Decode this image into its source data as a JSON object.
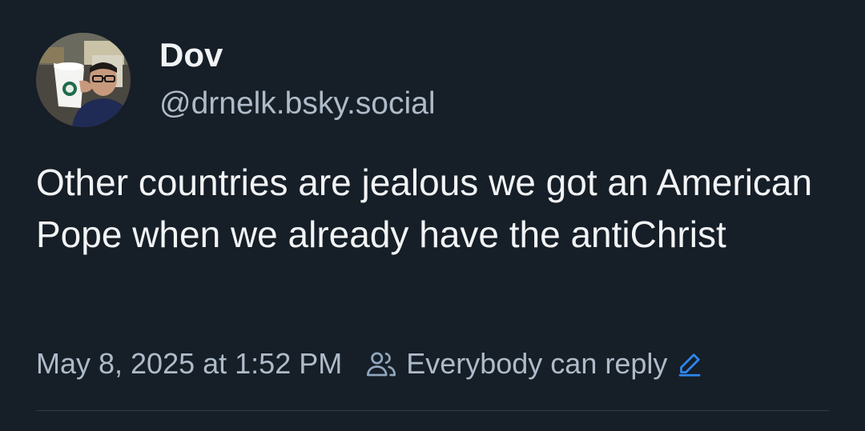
{
  "author": {
    "display_name": "Dov",
    "handle": "@drnelk.bsky.social",
    "avatar_icon": "avatar"
  },
  "post": {
    "text": "Other countries are jealous we got an American Pope when we already have the antiChrist",
    "timestamp": "May 8, 2025 at 1:52 PM"
  },
  "reply_settings": {
    "label": "Everybody can reply",
    "icon": "people-icon",
    "edit_icon": "pencil-icon"
  },
  "colors": {
    "background": "#161e27",
    "text_primary": "#f1f3f5",
    "text_secondary": "#aebbc9",
    "accent": "#2e87f0"
  }
}
